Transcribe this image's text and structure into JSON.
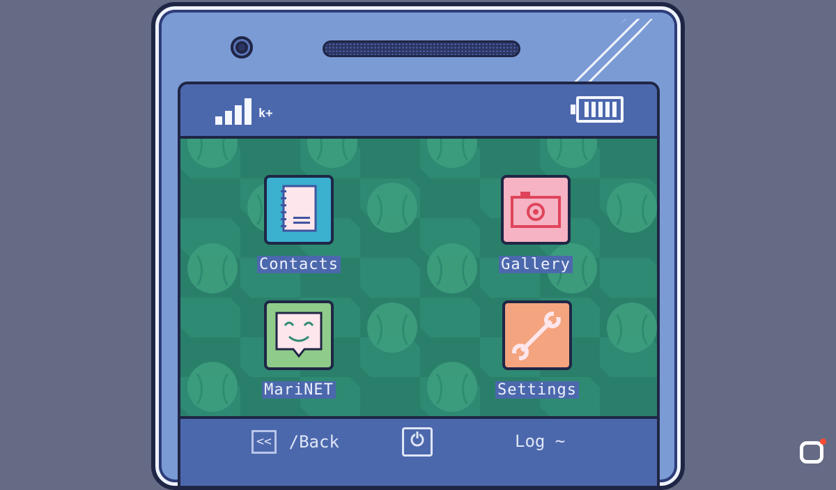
{
  "status": {
    "carrier": "k+",
    "signal_bars": 4,
    "battery_cells": 5
  },
  "apps": [
    {
      "label": "Contacts",
      "icon": "notebook-icon",
      "color": "#3bb0cf"
    },
    {
      "label": "Gallery",
      "icon": "camera-icon",
      "color": "#f5b3c3"
    },
    {
      "label": "MariNET",
      "icon": "smiley-chat-icon",
      "color": "#8fcc8a"
    },
    {
      "label": "Settings",
      "icon": "wrench-icon",
      "color": "#f4a47f"
    }
  ],
  "nav": {
    "back_key": "<<",
    "back_label": "/Back",
    "power_icon": "power-icon",
    "log_label": "Log ~"
  },
  "colors": {
    "background": "#656a85",
    "phone": "#7b9bd5",
    "screen_bar": "#4c68ad",
    "home_bg": "#2e8a72"
  }
}
